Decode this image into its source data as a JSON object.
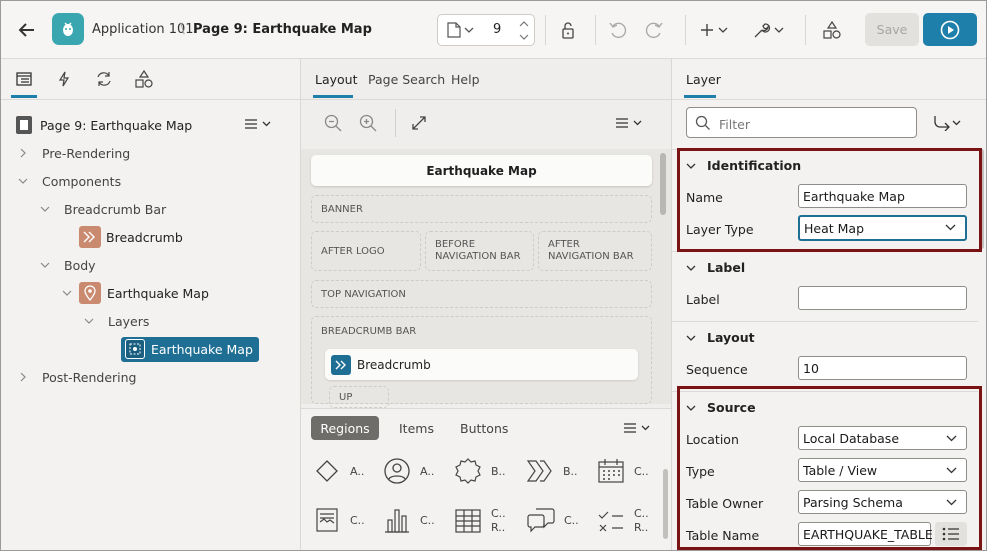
{
  "header": {
    "app_name": "Application 101",
    "page_title": "Page 9: Earthquake Map",
    "page_number": "9",
    "save_label": "Save"
  },
  "left_tree": {
    "root": "Page 9: Earthquake Map",
    "pre_rendering": "Pre-Rendering",
    "components": "Components",
    "breadcrumb_bar": "Breadcrumb Bar",
    "breadcrumb": "Breadcrumb",
    "body": "Body",
    "earthquake_map": "Earthquake Map",
    "layers": "Layers",
    "layer_selected": "Earthquake Map",
    "post_rendering": "Post-Rendering"
  },
  "middle": {
    "tabs": [
      "Layout",
      "Page Search",
      "Help"
    ],
    "canvas_title": "Earthquake Map",
    "slots": {
      "banner": "BANNER",
      "after_logo": "AFTER LOGO",
      "before_nav_1": "BEFORE",
      "before_nav_2": "NAVIGATION BAR",
      "after_nav_1": "AFTER",
      "after_nav_2": "NAVIGATION BAR",
      "top_navigation": "TOP NAVIGATION",
      "breadcrumb_bar": "BREADCRUMB BAR",
      "breadcrumb_region": "Breadcrumb",
      "up": "UP"
    },
    "gallery_tabs": [
      "Regions",
      "Items",
      "Buttons"
    ],
    "gallery_items": [
      "A..",
      "A..",
      "B..",
      "B..",
      "C..",
      "C..",
      "C..",
      "C..",
      "R..",
      "C..",
      "C..",
      "R.."
    ]
  },
  "right": {
    "tab": "Layer",
    "filter_placeholder": "Filter",
    "identification": {
      "title": "Identification",
      "name_label": "Name",
      "name_value": "Earthquake Map",
      "layer_type_label": "Layer Type",
      "layer_type_value": "Heat Map"
    },
    "label_section": {
      "title": "Label",
      "label_label": "Label",
      "label_value": ""
    },
    "layout": {
      "title": "Layout",
      "sequence_label": "Sequence",
      "sequence_value": "10"
    },
    "source": {
      "title": "Source",
      "location_label": "Location",
      "location_value": "Local Database",
      "type_label": "Type",
      "type_value": "Table / View",
      "table_owner_label": "Table Owner",
      "table_owner_value": "Parsing Schema",
      "table_name_label": "Table Name",
      "table_name_value": "EARTHQUAKE_TABLE"
    }
  },
  "colors": {
    "accent": "#1f7fab",
    "selected": "#1f6f95",
    "highlight": "#7a1313",
    "app_badge": "#3aa7b0",
    "component_icon": "#c98a6f"
  }
}
